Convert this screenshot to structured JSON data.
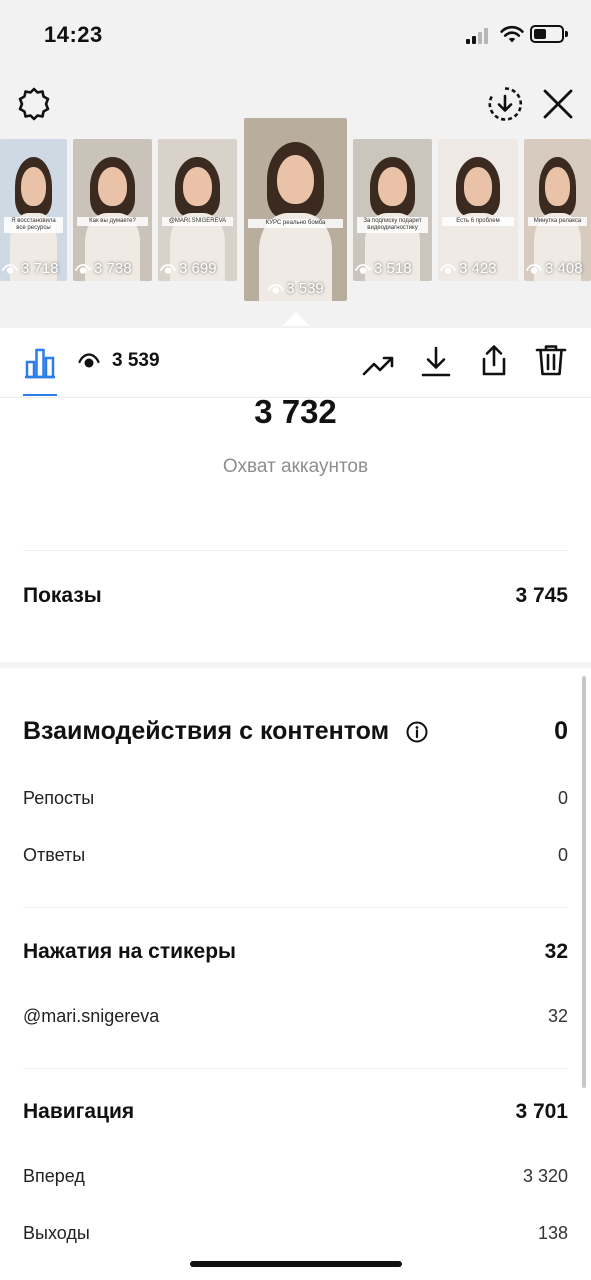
{
  "status": {
    "time": "14:23"
  },
  "thumbnails": [
    {
      "views": "3 718",
      "bg": "#cfd9e4",
      "caption": "Я восстановила все ресурсы"
    },
    {
      "views": "3 738",
      "bg": "#c9c3ba",
      "caption": "Как вы думаете?"
    },
    {
      "views": "3 699",
      "bg": "#d8d2cb",
      "caption": "@MARI.SNIGEREVA"
    },
    {
      "views": "3 539",
      "bg": "#b9ad9e",
      "caption": "КУРС реально бомба",
      "active": true
    },
    {
      "views": "3 518",
      "bg": "#cbc6bd",
      "caption": "За подписку подарит видеодиагностику"
    },
    {
      "views": "3 423",
      "bg": "#efe9e6",
      "caption": "Есть 6 проблем"
    },
    {
      "views": "3 408",
      "bg": "#d7cbbf",
      "caption": "Минутка релакса"
    }
  ],
  "toolbar": {
    "views": "3 539"
  },
  "reach": {
    "value": "3 732",
    "label": "Охват аккаунтов"
  },
  "impressions": {
    "label": "Показы",
    "value": "3 745"
  },
  "interactions": {
    "label": "Взаимодействия с контентом",
    "value": "0",
    "items": [
      {
        "label": "Репосты",
        "value": "0"
      },
      {
        "label": "Ответы",
        "value": "0"
      }
    ]
  },
  "stickers": {
    "label": "Нажатия на стикеры",
    "value": "32",
    "items": [
      {
        "label": "@mari.snigereva",
        "value": "32"
      }
    ]
  },
  "navigation": {
    "label": "Навигация",
    "value": "3 701",
    "items": [
      {
        "label": "Вперед",
        "value": "3 320"
      },
      {
        "label": "Выходы",
        "value": "138"
      }
    ]
  },
  "colors": {
    "accent": "#2b7de9",
    "muted": "#8e8e8e"
  }
}
